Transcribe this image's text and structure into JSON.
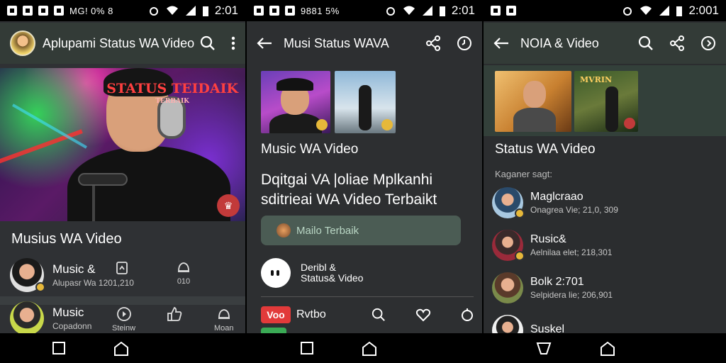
{
  "panels": [
    {
      "status": {
        "left_text": "MG! 0% 8",
        "time": "2:01"
      },
      "appbar": {
        "title": "Aplupami Status WA Video"
      },
      "hero": {
        "sign_main": "STATUS TEIDAIK",
        "sign_sub": "TERBAIK",
        "badge": "♛"
      },
      "section_title": "Musius WA Video",
      "items": [
        {
          "title": "Music &",
          "subtitle": "Alupasr Wa 1201,210",
          "icon_count": "010"
        },
        {
          "title": "Music",
          "subtitle": "Copadonn",
          "icon_label_1": "Steinw",
          "icon_label_2": "Moan"
        }
      ]
    },
    {
      "status": {
        "left_text": "9881 5%",
        "time": "2:01"
      },
      "appbar": {
        "title": "Musi Status WAVA"
      },
      "section_title": "Music WA Video",
      "headline": "Dqitgai VA |oliae Mplkanhi sditrieai WA Video Terbaikt",
      "pill": "Mailo Terbaik",
      "row": {
        "line1": "Deribl &",
        "line2": "Status& Video"
      },
      "bottom": {
        "logo": "Voo",
        "brand": "Rvtbo"
      }
    },
    {
      "status": {
        "time": "2:001"
      },
      "appbar": {
        "title": "NOIA & Video"
      },
      "thumb_sign": "MVRIN",
      "section_title": "Status WA Video",
      "subheading": "Kaganer sagt:",
      "items": [
        {
          "title": "Maglcraao",
          "subtitle": "Onagrea Vie; 21,0, 309"
        },
        {
          "title": "Rusic&",
          "subtitle": "Aelnilaa elet; 218,301"
        },
        {
          "title": "Bolk 2:701",
          "subtitle": "Selpidera lie; 206,901"
        },
        {
          "title": "Suskel",
          "subtitle": ""
        }
      ]
    }
  ],
  "icons": {
    "search": "search-icon",
    "more": "more-vert-icon",
    "share": "share-icon",
    "back": "back-arrow-icon",
    "history": "history-icon",
    "heart": "heart-icon",
    "nav_back": "nav-back-icon",
    "nav_home": "nav-home-icon",
    "nav_recent": "nav-recent-icon"
  },
  "colors": {
    "appbar": "#333b37",
    "background": "#2f3134",
    "accent_red": "#e23a3a",
    "pill": "#4b5c54",
    "badge_gold": "#e6b83a"
  }
}
